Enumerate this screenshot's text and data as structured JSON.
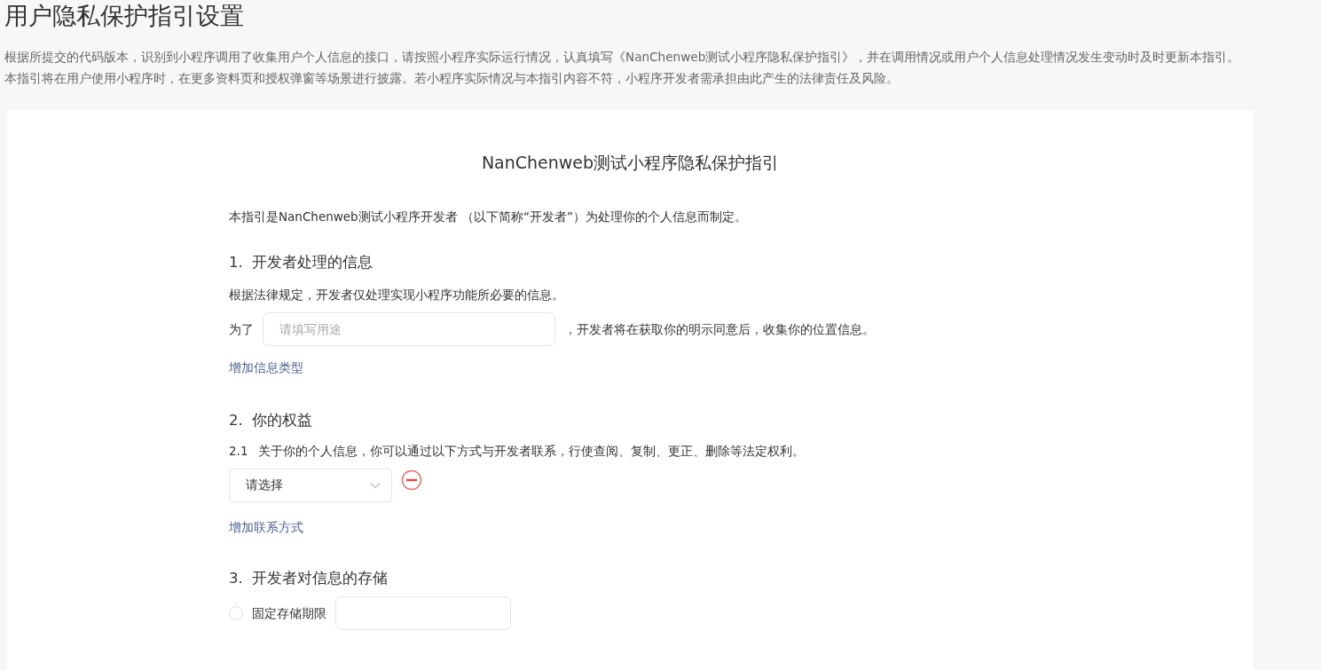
{
  "page_title": "用户隐私保护指引设置",
  "description": [
    "根据所提交的代码版本，识别到小程序调用了收集用户个人信息的接口，请按照小程序实际运行情况，认真填写《NanChenweb测试小程序隐私保护指引》，并在调用情况或用户个人信息处理情况发生变动时及时更新本指引。",
    "本指引将在用户使用小程序时，在更多资料页和授权弹窗等场景进行披露。若小程序实际情况与本指引内容不符，小程序开发者需承担由此产生的法律责任及风险。"
  ],
  "guide": {
    "title": "NanChenweb测试小程序隐私保护指引",
    "intro": "本指引是NanChenweb测试小程序开发者 （以下简称“开发者”）为处理你的个人信息而制定。",
    "section_1": {
      "heading": "1.  开发者处理的信息",
      "note": "根据法律规定，开发者仅处理实现小程序功能所必要的信息。",
      "purpose_row": {
        "prefix": "为了",
        "placeholder": "请填写用途",
        "suffix": "，开发者将在获取你的明示同意后，收集你的位置信息。"
      },
      "add_link": "增加信息类型"
    },
    "section_2": {
      "heading": "2.  你的权益",
      "item_number": "2.1",
      "item_text": "关于你的个人信息，你可以通过以下方式与开发者联系，行使查阅、复制、更正、删除等法定权利。",
      "contact_select": {
        "value": "请选择"
      },
      "add_link": "增加联系方式"
    },
    "section_3": {
      "heading": "3.  开发者对信息的存储",
      "options": [
        {
          "label": "固定存储期限",
          "selected": false
        }
      ]
    }
  }
}
